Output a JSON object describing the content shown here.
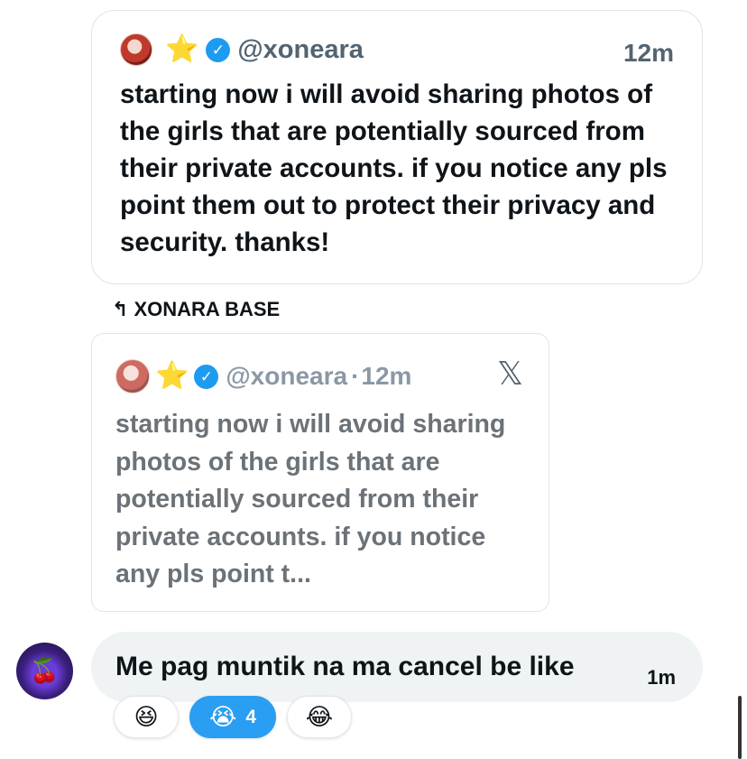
{
  "quoted_post": {
    "handle": "@xoneara",
    "star": "⭐",
    "time": "12m",
    "text": "starting now i will avoid sharing photos of the girls that are potentially sourced from their private accounts. if you notice any pls point them out to protect their privacy and security. thanks!"
  },
  "reply_context": {
    "label": "XONARA BASE",
    "icon": "reply-arrow-icon"
  },
  "embedded_post": {
    "handle": "@xoneara",
    "separator": "·",
    "star": "⭐",
    "time": "12m",
    "x_logo": "𝕏",
    "text": "starting now i will avoid sharing photos of the girls that are potentially sourced from their private accounts. if you notice any pls point t..."
  },
  "message": {
    "text": "Me pag muntik na ma cancel be like",
    "time": "1m",
    "avatar_icon": "🍒"
  },
  "reactions": [
    {
      "emoji": "😆",
      "count": ""
    },
    {
      "emoji": "😭",
      "count": "4",
      "active": true
    },
    {
      "emoji": "😂",
      "count": ""
    }
  ],
  "colors": {
    "verified": "#1d9bf0",
    "active_reaction": "#2a9ef2",
    "bubble": "#eff3f4"
  }
}
